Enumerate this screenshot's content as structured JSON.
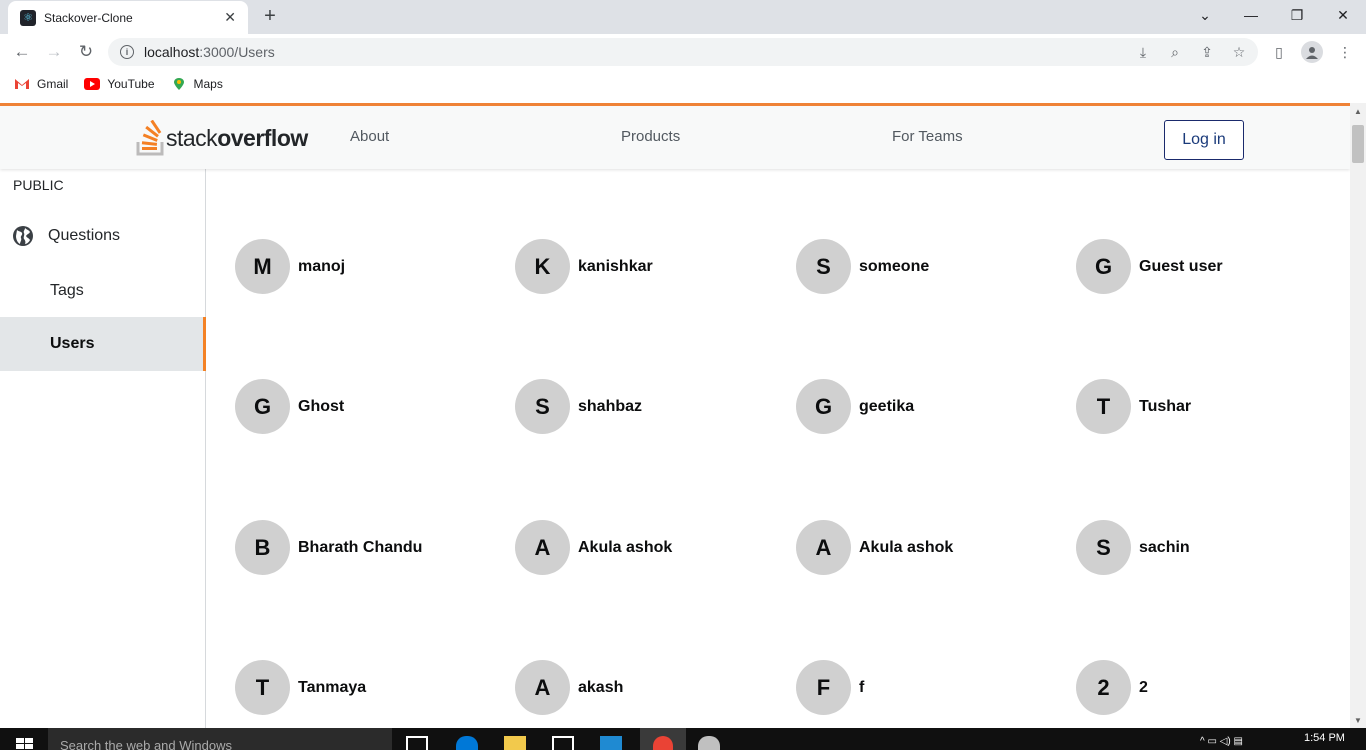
{
  "browser": {
    "tab_title": "Stackover-Clone",
    "tab_close": "✕",
    "new_tab": "+",
    "url_host": "localhost",
    "url_path": ":3000/Users",
    "bookmarks": [
      "Gmail",
      "YouTube",
      "Maps"
    ]
  },
  "header": {
    "logo_prefix": "stack",
    "logo_bold": "overflow",
    "nav": [
      "About",
      "Products",
      "For Teams"
    ],
    "login_label": "Log in"
  },
  "sidebar": {
    "public_label": "PUBLIC",
    "questions_label": "Questions",
    "tags_label": "Tags",
    "users_label": "Users"
  },
  "users": [
    {
      "initial": "M",
      "name": "manoj"
    },
    {
      "initial": "K",
      "name": "kanishkar"
    },
    {
      "initial": "S",
      "name": "someone"
    },
    {
      "initial": "G",
      "name": "Guest user"
    },
    {
      "initial": "G",
      "name": "Ghost"
    },
    {
      "initial": "S",
      "name": "shahbaz"
    },
    {
      "initial": "G",
      "name": "geetika"
    },
    {
      "initial": "T",
      "name": "Tushar"
    },
    {
      "initial": "B",
      "name": "Bharath Chandu"
    },
    {
      "initial": "A",
      "name": "Akula ashok"
    },
    {
      "initial": "A",
      "name": "Akula ashok"
    },
    {
      "initial": "S",
      "name": "sachin"
    },
    {
      "initial": "T",
      "name": "Tanmaya"
    },
    {
      "initial": "A",
      "name": "akash"
    },
    {
      "initial": "F",
      "name": "f"
    },
    {
      "initial": "2",
      "name": "2"
    }
  ],
  "taskbar": {
    "search_placeholder": "Search the web and Windows",
    "time": "1:54 PM"
  },
  "colors": {
    "accent": "#f48225",
    "avatar_bg": "#d0d0d0",
    "login_border": "#1a2a6c"
  }
}
